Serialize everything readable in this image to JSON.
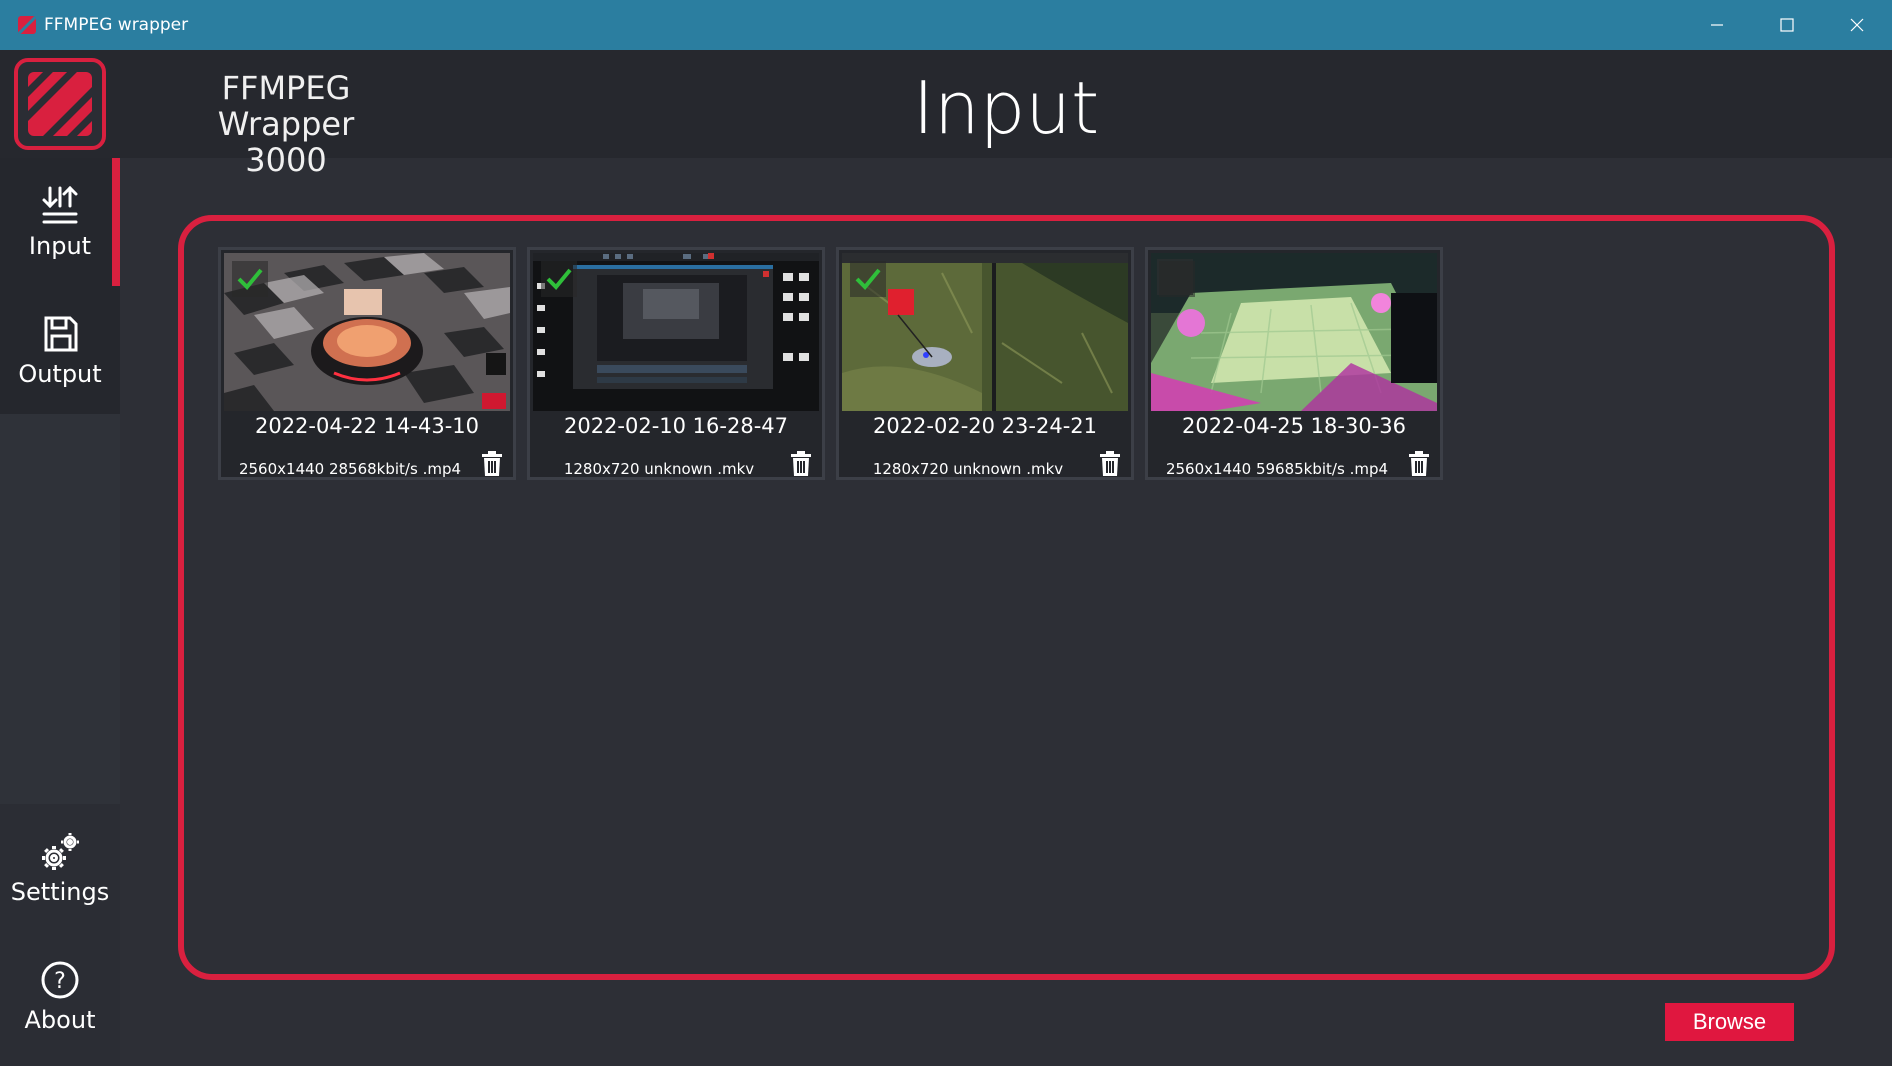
{
  "window": {
    "title": "FFMPEG wrapper",
    "minimize_icon": "minimize-icon",
    "maximize_icon": "maximize-icon",
    "close_icon": "close-icon"
  },
  "brand": {
    "line1": "FFMPEG Wrapper",
    "line2": "3000"
  },
  "page": {
    "title": "Input"
  },
  "sidebar": {
    "items": [
      {
        "label": "Input",
        "icon": "input-arrows-icon",
        "active": true
      },
      {
        "label": "Output",
        "icon": "save-disk-icon",
        "active": false
      },
      {
        "label": "Settings",
        "icon": "gears-icon",
        "active": false
      },
      {
        "label": "About",
        "icon": "question-icon",
        "active": false
      }
    ]
  },
  "files": [
    {
      "name": "2022-04-22 14-43-10",
      "meta": "2560x1440 28568kbit/s .mp4",
      "checked": true
    },
    {
      "name": "2022-02-10 16-28-47",
      "meta": "1280x720 unknown .mkv",
      "checked": true
    },
    {
      "name": "2022-02-20 23-24-21",
      "meta": "1280x720 unknown .mkv",
      "checked": true
    },
    {
      "name": "2022-04-25 18-30-36",
      "meta": "2560x1440 59685kbit/s .mp4",
      "checked": false
    }
  ],
  "actions": {
    "browse_label": "Browse"
  },
  "colors": {
    "accent": "#d9203f",
    "titlebar": "#2b7ea0",
    "background": "#2d2f36"
  }
}
